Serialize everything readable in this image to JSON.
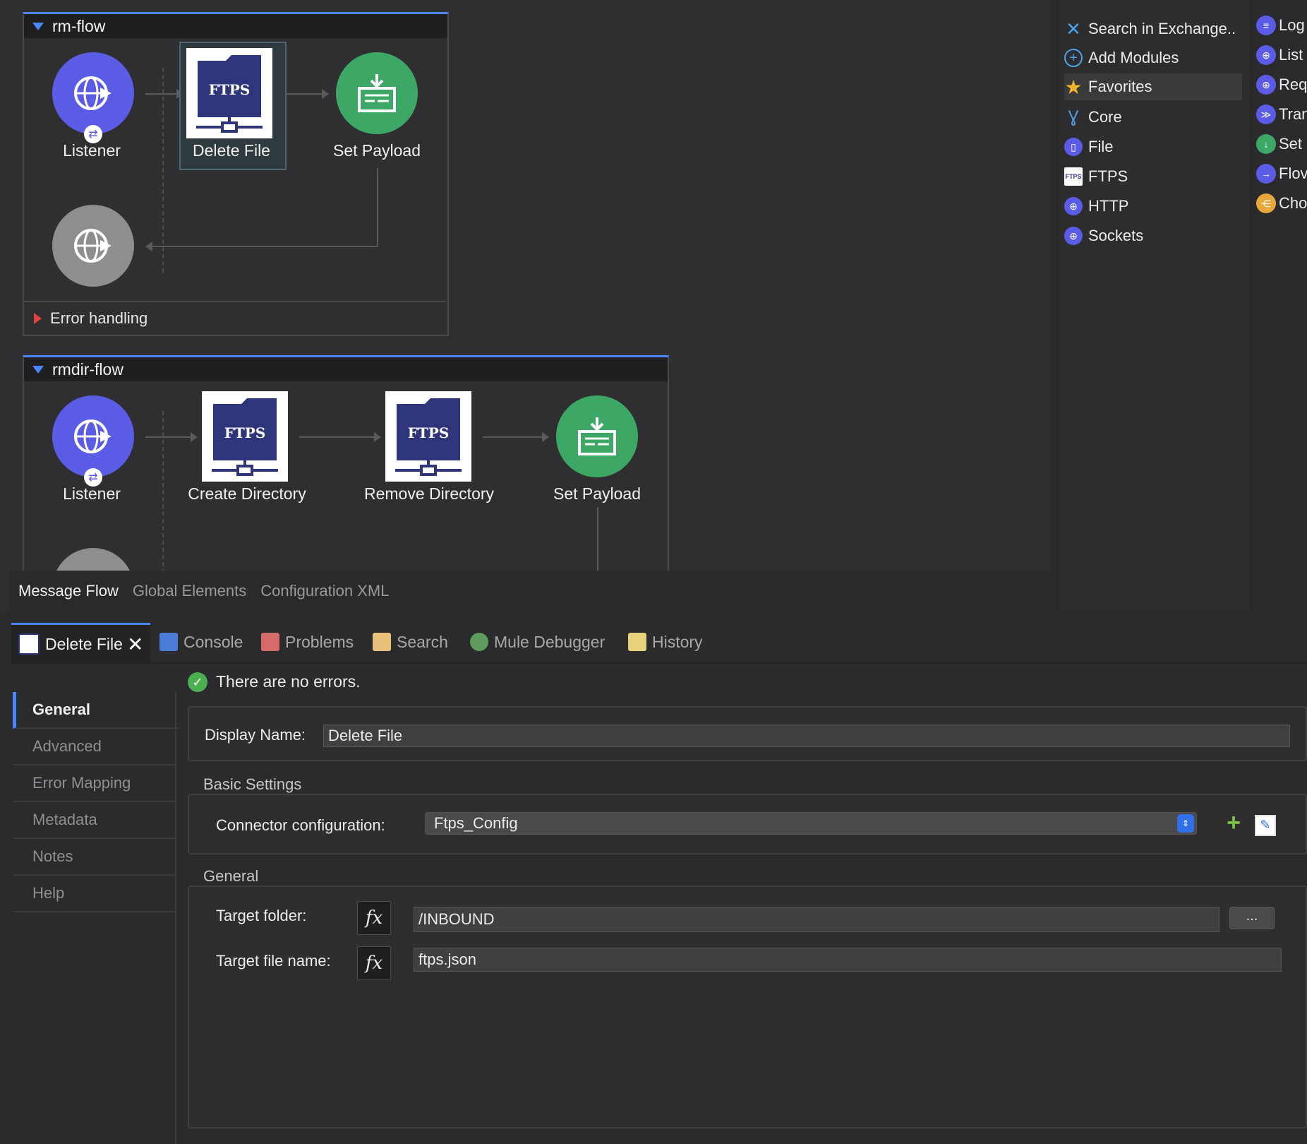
{
  "flows": [
    {
      "name": "rm-flow",
      "nodes": [
        {
          "label": "Listener",
          "icon": "globe-icon",
          "color": "#5b5ce6"
        },
        {
          "label": "Delete File",
          "icon": "ftps-icon",
          "badge": "FTPS"
        },
        {
          "label": "Set Payload",
          "icon": "set-payload-icon",
          "color": "#3da866"
        }
      ],
      "error_handling": "Error handling"
    },
    {
      "name": "rmdir-flow",
      "nodes": [
        {
          "label": "Listener",
          "icon": "globe-icon",
          "color": "#5b5ce6"
        },
        {
          "label": "Create Directory",
          "icon": "ftps-icon",
          "badge": "FTPS"
        },
        {
          "label": "Remove Directory",
          "icon": "ftps-icon",
          "badge": "FTPS"
        },
        {
          "label": "Set Payload",
          "icon": "set-payload-icon",
          "color": "#3da866"
        }
      ]
    }
  ],
  "view_tabs": [
    "Message Flow",
    "Global Elements",
    "Configuration XML"
  ],
  "palette": {
    "left_items": [
      {
        "label": "Search in Exchange..",
        "icon": "exchange-icon"
      },
      {
        "label": "Add Modules",
        "icon": "add-circle-icon"
      },
      {
        "label": "Favorites",
        "icon": "star-icon",
        "selected": true
      },
      {
        "label": "Core",
        "icon": "core-icon"
      },
      {
        "label": "File",
        "icon": "file-icon"
      },
      {
        "label": "FTPS",
        "icon": "ftps-icon"
      },
      {
        "label": "HTTP",
        "icon": "http-icon"
      },
      {
        "label": "Sockets",
        "icon": "sockets-icon"
      }
    ],
    "right_items": [
      {
        "label": "Log",
        "icon": "logger-icon",
        "color": "#5b5ce6"
      },
      {
        "label": "List",
        "icon": "listener-icon",
        "color": "#5b5ce6"
      },
      {
        "label": "Req",
        "icon": "request-icon",
        "color": "#5b5ce6"
      },
      {
        "label": "Tran",
        "icon": "transform-icon",
        "color": "#5b5ce6"
      },
      {
        "label": "Set",
        "icon": "set-payload-icon",
        "color": "#3da866"
      },
      {
        "label": "Flov",
        "icon": "flow-ref-icon",
        "color": "#5b5ce6"
      },
      {
        "label": "Cho",
        "icon": "choice-icon",
        "color": "#e8a93a"
      }
    ]
  },
  "panel_tabs": [
    {
      "label": "Delete File",
      "active": true
    },
    {
      "label": "Console"
    },
    {
      "label": "Problems"
    },
    {
      "label": "Search"
    },
    {
      "label": "Mule Debugger"
    },
    {
      "label": "History"
    }
  ],
  "sidenav": [
    "General",
    "Advanced",
    "Error Mapping",
    "Metadata",
    "Notes",
    "Help"
  ],
  "status": "There are no errors.",
  "display_name": {
    "label": "Display Name:",
    "value": "Delete File"
  },
  "basic_settings": {
    "title": "Basic Settings",
    "connector_label": "Connector configuration:",
    "connector_value": "Ftps_Config"
  },
  "general": {
    "title": "General",
    "target_folder_label": "Target folder:",
    "target_folder_value": "/INBOUND",
    "target_file_label": "Target file name:",
    "target_file_value": "ftps.json",
    "browse_label": "...",
    "fx_label": "fx"
  }
}
